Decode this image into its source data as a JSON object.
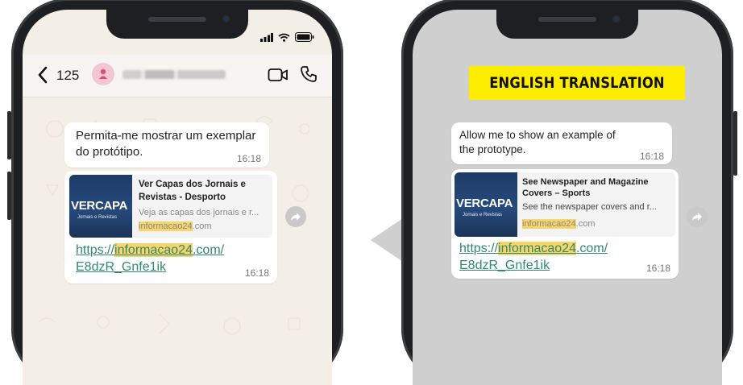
{
  "left_phone": {
    "status": {
      "signal": "signal-icon",
      "wifi": "wifi-icon",
      "battery": "battery-icon"
    },
    "header": {
      "back_count": "125",
      "contact_name": "",
      "icons": [
        "chevron-left-icon",
        "contact-avatar-icon",
        "video-call-icon",
        "voice-call-icon"
      ]
    },
    "message_1": {
      "text_line1": "Permita-me mostrar um exemplar",
      "text_line2": "do protótipo.",
      "time": "16:18"
    },
    "message_2": {
      "thumb_name": "VERCAPA",
      "thumb_sub": "Jornais e Revistas",
      "preview_title_line1": "Ver Capas dos Jornais e",
      "preview_title_line2": "Revistas - Desporto",
      "preview_desc": "Veja as capas dos jornais e r...",
      "preview_domain_hl": "informacao24",
      "preview_domain_rest": ".com",
      "link_prefix": "https://",
      "link_hl": "informacao24",
      "link_suffix": ".com/",
      "link_line2": "E8dzR_Gnfe1ik",
      "time": "16:18"
    }
  },
  "right_phone": {
    "banner": "ENGLISH TRANSLATION",
    "message_1": {
      "text_line1": "Allow me to show an example of",
      "text_line2": "the prototype.",
      "time": "16:18"
    },
    "message_2": {
      "thumb_name": "VERCAPA",
      "thumb_sub": "Jornais e Revistas",
      "preview_title_line1": "See Newspaper and Magazine",
      "preview_title_line2": "Covers – Sports",
      "preview_desc": "See the newspaper covers and r...",
      "preview_domain_hl": "informacao24",
      "preview_domain_rest": ".com",
      "link_prefix": "https://",
      "link_hl": "informacao24",
      "link_suffix": ".com/",
      "link_line2": "E8dzR_Gnfe1ik",
      "time": "16:18"
    }
  },
  "colors": {
    "highlight": "#f7d56c",
    "banner": "#ffed00",
    "link": "#2e8b6b",
    "avatar": "#f3c6d3"
  }
}
